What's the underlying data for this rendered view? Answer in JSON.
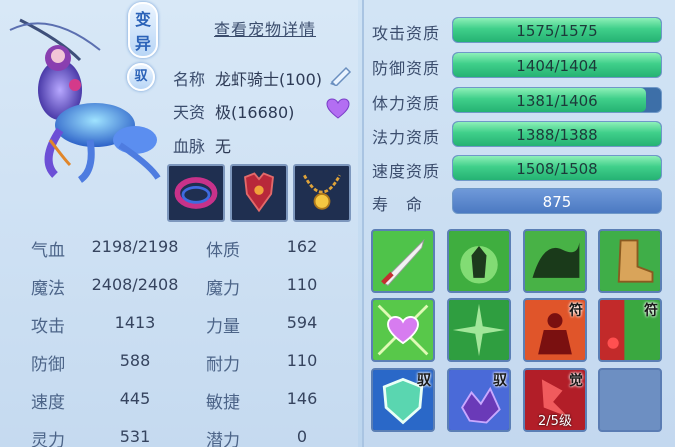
{
  "header": {
    "mutant_badge": "变异",
    "yu_badge": "驭",
    "detail_link": "查看宠物详情"
  },
  "pet": {
    "name_label": "名称",
    "name_value": "龙虾骑士(100)",
    "aptitude_label": "天资",
    "aptitude_value": "极(16680)",
    "blood_label": "血脉",
    "blood_value": "无"
  },
  "equipment": [
    {
      "icon": "bracelet-icon"
    },
    {
      "icon": "armor-icon"
    },
    {
      "icon": "necklace-icon"
    }
  ],
  "attributes": {
    "hp_label": "气血",
    "hp_value": "2198/2198",
    "mp_label": "魔法",
    "mp_value": "2408/2408",
    "atk_label": "攻击",
    "atk_value": "1413",
    "def_label": "防御",
    "def_value": "588",
    "spd_label": "速度",
    "spd_value": "445",
    "spirit_label": "灵力",
    "spirit_value": "531",
    "con_label": "体质",
    "con_value": "162",
    "mag_label": "魔力",
    "mag_value": "110",
    "str_label": "力量",
    "str_value": "594",
    "end_label": "耐力",
    "end_value": "110",
    "agi_label": "敏捷",
    "agi_value": "146",
    "pot_label": "潜力",
    "pot_value": "0"
  },
  "qualifications": [
    {
      "label": "攻击资质",
      "text": "1575/1575",
      "fill": 1.0
    },
    {
      "label": "防御资质",
      "text": "1404/1404",
      "fill": 1.0
    },
    {
      "label": "体力资质",
      "text": "1381/1406",
      "fill": 0.93
    },
    {
      "label": "法力资质",
      "text": "1388/1388",
      "fill": 1.0
    },
    {
      "label": "速度资质",
      "text": "1508/1508",
      "fill": 1.0
    }
  ],
  "lifespan": {
    "label": "寿　命",
    "value": "875"
  },
  "skills": [
    {
      "icon": "sword-skill-icon"
    },
    {
      "icon": "shadow-warrior-skill-icon"
    },
    {
      "icon": "dragon-skill-icon"
    },
    {
      "icon": "boot-skill-icon"
    },
    {
      "icon": "heart-skill-icon"
    },
    {
      "icon": "shatter-skill-icon"
    },
    {
      "icon": "figure-talisman-skill-icon",
      "badge": "符"
    },
    {
      "icon": "blood-talisman-skill-icon",
      "badge": "符"
    },
    {
      "icon": "shield-yu-skill-icon",
      "badge": "驭"
    },
    {
      "icon": "crystal-yu-skill-icon",
      "badge": "驭"
    },
    {
      "icon": "awaken-skill-icon",
      "badge": "觉",
      "level": "2/5级"
    },
    {
      "icon": "empty-slot"
    }
  ],
  "colors": {
    "bar_fill": "#3fcf8a",
    "bar_bg": "#3d6fa8",
    "accent_text": "#2b62b8"
  }
}
